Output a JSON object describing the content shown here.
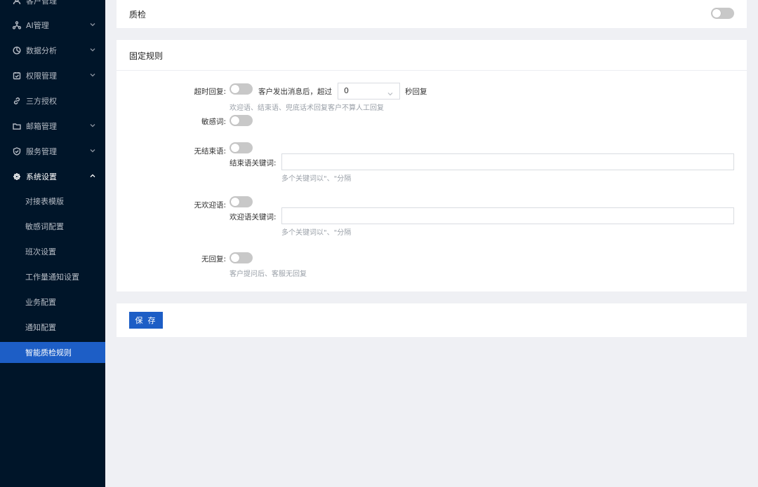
{
  "sidebar": {
    "items": [
      {
        "label": "客户管理",
        "icon": "customer-icon"
      },
      {
        "label": "AI管理",
        "icon": "ai-network-icon"
      },
      {
        "label": "数据分析",
        "icon": "analytics-icon"
      },
      {
        "label": "权限管理",
        "icon": "permission-icon"
      },
      {
        "label": "三方授权",
        "icon": "link-icon"
      },
      {
        "label": "邮箱管理",
        "icon": "folder-icon"
      },
      {
        "label": "服务管理",
        "icon": "shield-check-icon"
      },
      {
        "label": "系统设置",
        "icon": "gear-icon"
      }
    ],
    "subitems": [
      {
        "label": "对接表模版"
      },
      {
        "label": "敏感词配置"
      },
      {
        "label": "班次设置"
      },
      {
        "label": "工作量通知设置"
      },
      {
        "label": "业务配置"
      },
      {
        "label": "通知配置"
      },
      {
        "label": "智能质检规则"
      }
    ],
    "active_subitem": "智能质检规则"
  },
  "quality_check": {
    "title": "质检",
    "enabled": false
  },
  "rules": {
    "title": "固定规则",
    "timeout_reply": {
      "label": "超时回复:",
      "enabled": false,
      "prefix": "客户发出消息后，超过",
      "seconds_value": "0",
      "suffix": "秒回复",
      "hint": "欢迎语、结束语、兜底话术回复客户不算人工回复"
    },
    "sensitive_words": {
      "label": "敏感词:",
      "enabled": false
    },
    "no_closing": {
      "label": "无结束语:",
      "enabled": false,
      "keywords_label": "结束语关键词:",
      "keywords_value": "",
      "hint": "多个关键词以\"、\"分隔"
    },
    "no_greeting": {
      "label": "无欢迎语:",
      "enabled": false,
      "keywords_label": "欢迎语关键词:",
      "keywords_value": "",
      "hint": "多个关键词以\"、\"分隔"
    },
    "no_reply": {
      "label": "无回复:",
      "enabled": false,
      "hint": "客户提问后、客服无回复"
    }
  },
  "actions": {
    "save_label": "保 存"
  },
  "colors": {
    "sidebar_bg": "#001529",
    "accent": "#1d5ec6",
    "page_bg": "#eff0f4"
  }
}
